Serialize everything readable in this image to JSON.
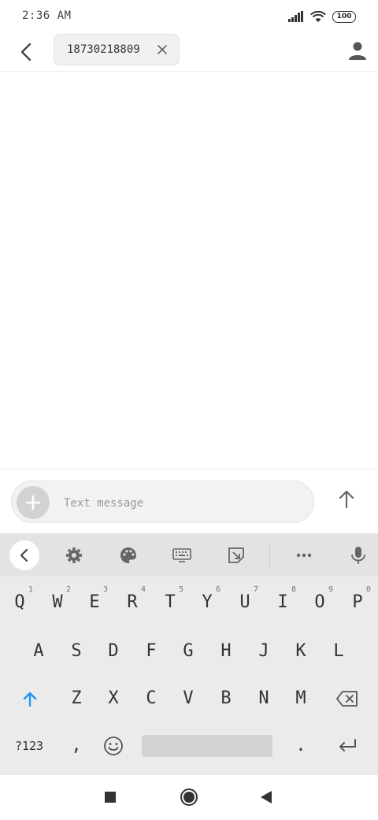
{
  "status_bar": {
    "time": "2:36 AM",
    "battery": "100"
  },
  "header": {
    "recipient": "18730218809"
  },
  "compose": {
    "placeholder": "Text message"
  },
  "keyboard": {
    "row1": [
      {
        "label": "Q",
        "hint": "1"
      },
      {
        "label": "W",
        "hint": "2"
      },
      {
        "label": "E",
        "hint": "3"
      },
      {
        "label": "R",
        "hint": "4"
      },
      {
        "label": "T",
        "hint": "5"
      },
      {
        "label": "Y",
        "hint": "6"
      },
      {
        "label": "U",
        "hint": "7"
      },
      {
        "label": "I",
        "hint": "8"
      },
      {
        "label": "O",
        "hint": "9"
      },
      {
        "label": "P",
        "hint": "0"
      }
    ],
    "row2": [
      "A",
      "S",
      "D",
      "F",
      "G",
      "H",
      "J",
      "K",
      "L"
    ],
    "row3": [
      "Z",
      "X",
      "C",
      "V",
      "B",
      "N",
      "M"
    ],
    "symbols_label": "?123",
    "comma": ",",
    "period": "."
  },
  "colors": {
    "accent": "#2196f3"
  }
}
